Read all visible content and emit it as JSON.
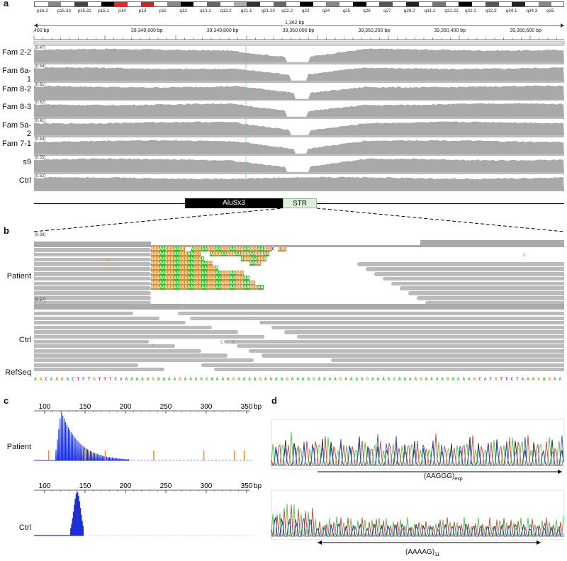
{
  "panel_labels": {
    "a": "a",
    "b": "b",
    "c": "c",
    "d": "d"
  },
  "panel_a": {
    "cytobands": [
      "p16.2",
      "p15.33",
      "p15.31",
      "p15.1",
      "p14",
      "p13",
      "p11",
      "q12",
      "q13.1",
      "q13.2",
      "q21.1",
      "q21.23",
      "q22.2",
      "q23",
      "q24",
      "q25",
      "q26",
      "q27",
      "q28.2",
      "q31.1",
      "q31.22",
      "q32.1",
      "q32.3",
      "q34.1",
      "q34.3",
      "q35"
    ],
    "span_label": "1,362 bp",
    "coords": [
      ",400 bp",
      "39,349,600 bp",
      "39,349,800 bp",
      "39,350,000 bp",
      "39,350,200 bp",
      "39,350,400 bp",
      "39,350,600 bp"
    ],
    "tracks": [
      {
        "name": "Fam 2-2",
        "scale": "[0.47]"
      },
      {
        "name": "Fam 6a-1",
        "scale": "[0.54]"
      },
      {
        "name": "Fam 8-2",
        "scale": "[0.61]"
      },
      {
        "name": "Fam 8-3",
        "scale": "[0.62]"
      },
      {
        "name": "Fam 5a-2",
        "scale": "[0.41]"
      },
      {
        "name": "Fam 7-1",
        "scale": "[0.44]"
      },
      {
        "name": "s9",
        "scale": "[0.55]"
      },
      {
        "name": "Ctrl",
        "scale": "[0.52]"
      }
    ],
    "annot_alu": "AluSx3",
    "annot_str": "STR"
  },
  "panel_b": {
    "patient_label": "Patient",
    "ctrl_label": "Ctrl",
    "refseq_label": "RefSeq",
    "patient_scale": "[0.39]",
    "ctrl_scale": "[0.57]",
    "refseq": "AGCAAGACTCTGTTTCAAAAAAGAAAAGAAAAGAAAAGAAAAGAAAAGAAAAGAAAAGAAAAGAAAAGAAAAGAAAAGAAAAGCATGTTCTAAAGAGAA",
    "patient_reads": [
      "GGGAAGGGAAGG  AGGGAAGGGAAGGGAAGGGAAGGGAAGGGC GGG",
      "GGGAAGGGAAGGGAAGGG   AGGGAAGGGAAGGGAAGGGAA",
      "GGGAAGGGAAGGGAAGGGA             AGGGAAGGG",
      "GGGAAGGGAAGGGAAGGGAAGG             AAGG",
      "GGGAAGGGAAGGGAAGGGAAGGGA",
      "GGGAAGGGAAGGGAAGGGAAGGGAAGGGAAGGG",
      "GGGAAGGGAAGGGAAGGGAAGGGAAGGGAAGGGAA",
      "GGGAAGGGAAGGGAAGGGAAGGGAAGGGAAGGGAAGG",
      "GGGAAGGGAAGGGAAGGGAAGGGAAGGGAAGGGAAGGGAA"
    ],
    "snp_g": "G",
    "snp_c": "C"
  },
  "panel_c": {
    "ticks": [
      "100",
      "150",
      "200",
      "250",
      "300",
      "350"
    ],
    "unit": "bp",
    "patient_label": "Patient",
    "ctrl_label": "Ctrl"
  },
  "panel_d": {
    "label_exp": "(AAGGG)",
    "label_exp_sub": "exp",
    "label_11": "(AAAAG)",
    "label_11_sub": "11"
  },
  "colors": {
    "coverage": "#a9a9a9",
    "read": "#b9b9b9",
    "A": "#2fbf2f",
    "G": "#d98c2b",
    "C": "#3b55d9",
    "T": "#d93030",
    "fsa_blue": "#1a2fd6",
    "fsa_orange": "#f28c28"
  }
}
